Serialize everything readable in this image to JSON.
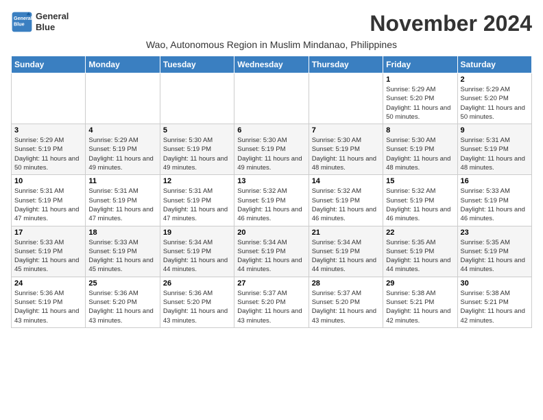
{
  "header": {
    "logo_line1": "General",
    "logo_line2": "Blue",
    "month_year": "November 2024",
    "subtitle": "Wao, Autonomous Region in Muslim Mindanao, Philippines"
  },
  "weekdays": [
    "Sunday",
    "Monday",
    "Tuesday",
    "Wednesday",
    "Thursday",
    "Friday",
    "Saturday"
  ],
  "weeks": [
    [
      {
        "day": "",
        "sunrise": "",
        "sunset": "",
        "daylight": ""
      },
      {
        "day": "",
        "sunrise": "",
        "sunset": "",
        "daylight": ""
      },
      {
        "day": "",
        "sunrise": "",
        "sunset": "",
        "daylight": ""
      },
      {
        "day": "",
        "sunrise": "",
        "sunset": "",
        "daylight": ""
      },
      {
        "day": "",
        "sunrise": "",
        "sunset": "",
        "daylight": ""
      },
      {
        "day": "1",
        "sunrise": "Sunrise: 5:29 AM",
        "sunset": "Sunset: 5:20 PM",
        "daylight": "Daylight: 11 hours and 50 minutes."
      },
      {
        "day": "2",
        "sunrise": "Sunrise: 5:29 AM",
        "sunset": "Sunset: 5:20 PM",
        "daylight": "Daylight: 11 hours and 50 minutes."
      }
    ],
    [
      {
        "day": "3",
        "sunrise": "Sunrise: 5:29 AM",
        "sunset": "Sunset: 5:19 PM",
        "daylight": "Daylight: 11 hours and 50 minutes."
      },
      {
        "day": "4",
        "sunrise": "Sunrise: 5:29 AM",
        "sunset": "Sunset: 5:19 PM",
        "daylight": "Daylight: 11 hours and 49 minutes."
      },
      {
        "day": "5",
        "sunrise": "Sunrise: 5:30 AM",
        "sunset": "Sunset: 5:19 PM",
        "daylight": "Daylight: 11 hours and 49 minutes."
      },
      {
        "day": "6",
        "sunrise": "Sunrise: 5:30 AM",
        "sunset": "Sunset: 5:19 PM",
        "daylight": "Daylight: 11 hours and 49 minutes."
      },
      {
        "day": "7",
        "sunrise": "Sunrise: 5:30 AM",
        "sunset": "Sunset: 5:19 PM",
        "daylight": "Daylight: 11 hours and 48 minutes."
      },
      {
        "day": "8",
        "sunrise": "Sunrise: 5:30 AM",
        "sunset": "Sunset: 5:19 PM",
        "daylight": "Daylight: 11 hours and 48 minutes."
      },
      {
        "day": "9",
        "sunrise": "Sunrise: 5:31 AM",
        "sunset": "Sunset: 5:19 PM",
        "daylight": "Daylight: 11 hours and 48 minutes."
      }
    ],
    [
      {
        "day": "10",
        "sunrise": "Sunrise: 5:31 AM",
        "sunset": "Sunset: 5:19 PM",
        "daylight": "Daylight: 11 hours and 47 minutes."
      },
      {
        "day": "11",
        "sunrise": "Sunrise: 5:31 AM",
        "sunset": "Sunset: 5:19 PM",
        "daylight": "Daylight: 11 hours and 47 minutes."
      },
      {
        "day": "12",
        "sunrise": "Sunrise: 5:31 AM",
        "sunset": "Sunset: 5:19 PM",
        "daylight": "Daylight: 11 hours and 47 minutes."
      },
      {
        "day": "13",
        "sunrise": "Sunrise: 5:32 AM",
        "sunset": "Sunset: 5:19 PM",
        "daylight": "Daylight: 11 hours and 46 minutes."
      },
      {
        "day": "14",
        "sunrise": "Sunrise: 5:32 AM",
        "sunset": "Sunset: 5:19 PM",
        "daylight": "Daylight: 11 hours and 46 minutes."
      },
      {
        "day": "15",
        "sunrise": "Sunrise: 5:32 AM",
        "sunset": "Sunset: 5:19 PM",
        "daylight": "Daylight: 11 hours and 46 minutes."
      },
      {
        "day": "16",
        "sunrise": "Sunrise: 5:33 AM",
        "sunset": "Sunset: 5:19 PM",
        "daylight": "Daylight: 11 hours and 46 minutes."
      }
    ],
    [
      {
        "day": "17",
        "sunrise": "Sunrise: 5:33 AM",
        "sunset": "Sunset: 5:19 PM",
        "daylight": "Daylight: 11 hours and 45 minutes."
      },
      {
        "day": "18",
        "sunrise": "Sunrise: 5:33 AM",
        "sunset": "Sunset: 5:19 PM",
        "daylight": "Daylight: 11 hours and 45 minutes."
      },
      {
        "day": "19",
        "sunrise": "Sunrise: 5:34 AM",
        "sunset": "Sunset: 5:19 PM",
        "daylight": "Daylight: 11 hours and 44 minutes."
      },
      {
        "day": "20",
        "sunrise": "Sunrise: 5:34 AM",
        "sunset": "Sunset: 5:19 PM",
        "daylight": "Daylight: 11 hours and 44 minutes."
      },
      {
        "day": "21",
        "sunrise": "Sunrise: 5:34 AM",
        "sunset": "Sunset: 5:19 PM",
        "daylight": "Daylight: 11 hours and 44 minutes."
      },
      {
        "day": "22",
        "sunrise": "Sunrise: 5:35 AM",
        "sunset": "Sunset: 5:19 PM",
        "daylight": "Daylight: 11 hours and 44 minutes."
      },
      {
        "day": "23",
        "sunrise": "Sunrise: 5:35 AM",
        "sunset": "Sunset: 5:19 PM",
        "daylight": "Daylight: 11 hours and 44 minutes."
      }
    ],
    [
      {
        "day": "24",
        "sunrise": "Sunrise: 5:36 AM",
        "sunset": "Sunset: 5:19 PM",
        "daylight": "Daylight: 11 hours and 43 minutes."
      },
      {
        "day": "25",
        "sunrise": "Sunrise: 5:36 AM",
        "sunset": "Sunset: 5:20 PM",
        "daylight": "Daylight: 11 hours and 43 minutes."
      },
      {
        "day": "26",
        "sunrise": "Sunrise: 5:36 AM",
        "sunset": "Sunset: 5:20 PM",
        "daylight": "Daylight: 11 hours and 43 minutes."
      },
      {
        "day": "27",
        "sunrise": "Sunrise: 5:37 AM",
        "sunset": "Sunset: 5:20 PM",
        "daylight": "Daylight: 11 hours and 43 minutes."
      },
      {
        "day": "28",
        "sunrise": "Sunrise: 5:37 AM",
        "sunset": "Sunset: 5:20 PM",
        "daylight": "Daylight: 11 hours and 43 minutes."
      },
      {
        "day": "29",
        "sunrise": "Sunrise: 5:38 AM",
        "sunset": "Sunset: 5:21 PM",
        "daylight": "Daylight: 11 hours and 42 minutes."
      },
      {
        "day": "30",
        "sunrise": "Sunrise: 5:38 AM",
        "sunset": "Sunset: 5:21 PM",
        "daylight": "Daylight: 11 hours and 42 minutes."
      }
    ]
  ]
}
